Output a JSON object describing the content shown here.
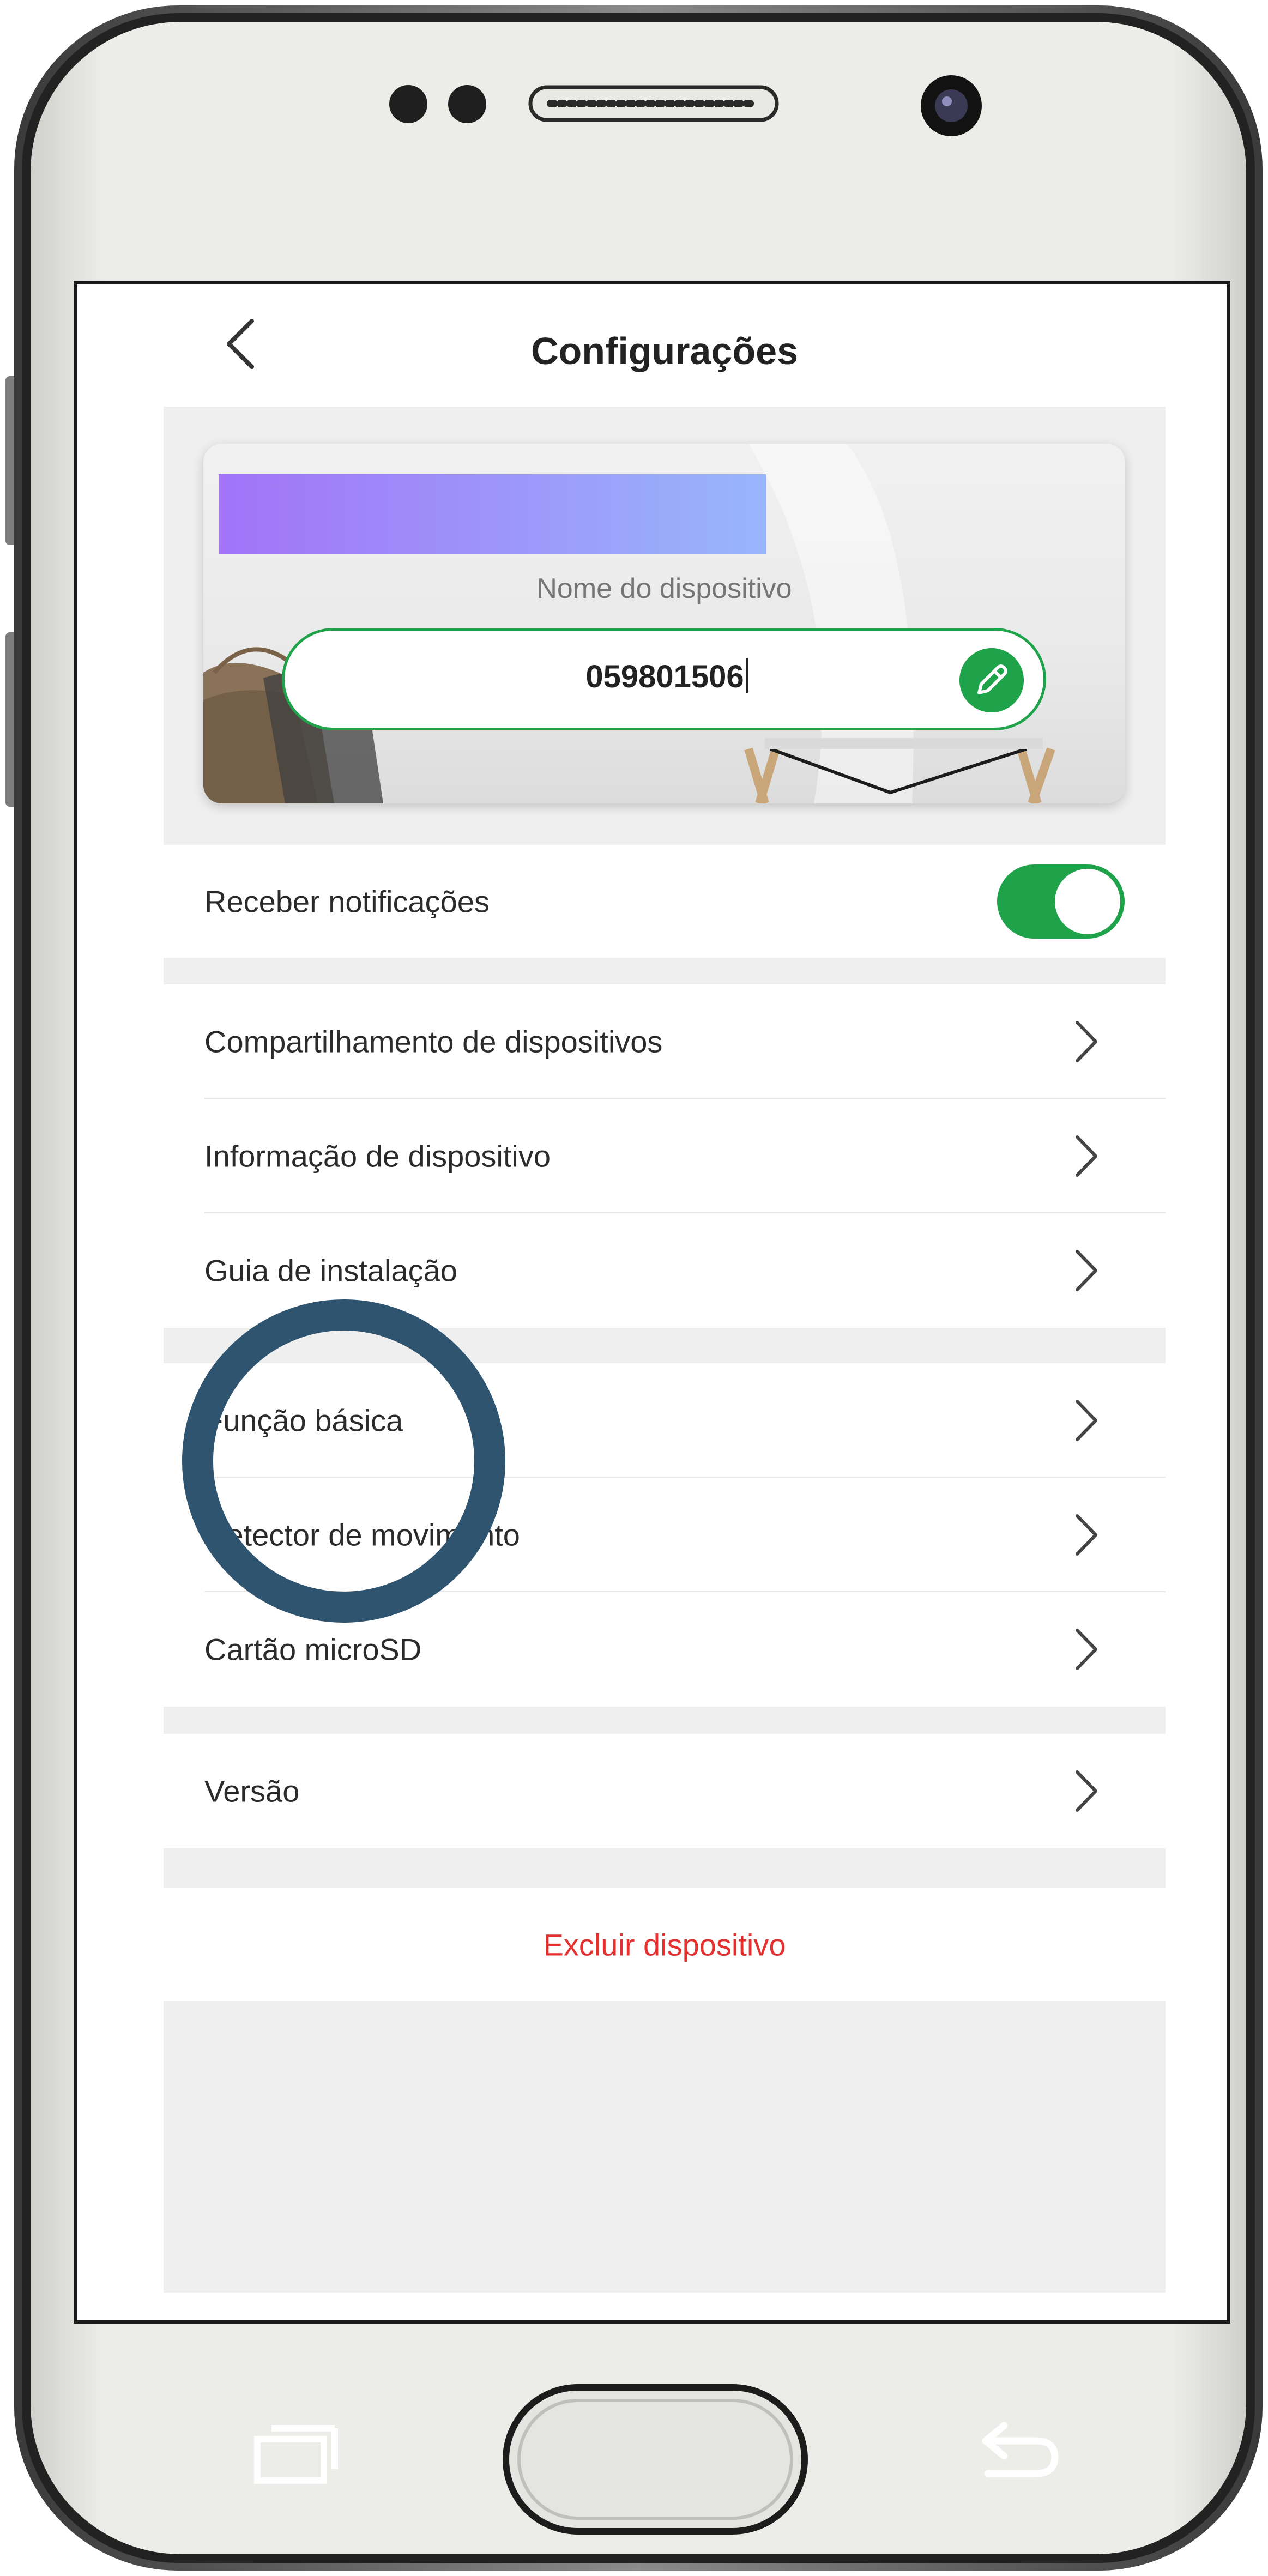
{
  "header": {
    "title": "Configurações"
  },
  "device_card": {
    "label": "Nome do dispositivo",
    "name_value": "059801506"
  },
  "notifications": {
    "label": "Receber notificações",
    "enabled": true
  },
  "menu_group_1": [
    {
      "label": "Compartilhamento de dispositivos"
    },
    {
      "label": "Informação de dispositivo"
    },
    {
      "label": "Guia de instalação"
    }
  ],
  "menu_group_2": [
    {
      "label": "Função básica"
    },
    {
      "label": "Detector de movimento"
    },
    {
      "label": "Cartão microSD"
    }
  ],
  "menu_group_3": [
    {
      "label": "Versão"
    }
  ],
  "delete_label": "Excluir dispositivo",
  "colors": {
    "accent_green": "#1fa34a",
    "danger_red": "#e53030",
    "marker_circle": "#2f5470",
    "gradient_start": "#a273f8",
    "gradient_end": "#98b6fb"
  },
  "icons": {
    "back": "chevron-left-icon",
    "row_arrow": "chevron-right-icon",
    "edit": "pencil-icon",
    "nav_recents": "recent-apps-icon",
    "nav_back": "back-arrow-icon"
  }
}
